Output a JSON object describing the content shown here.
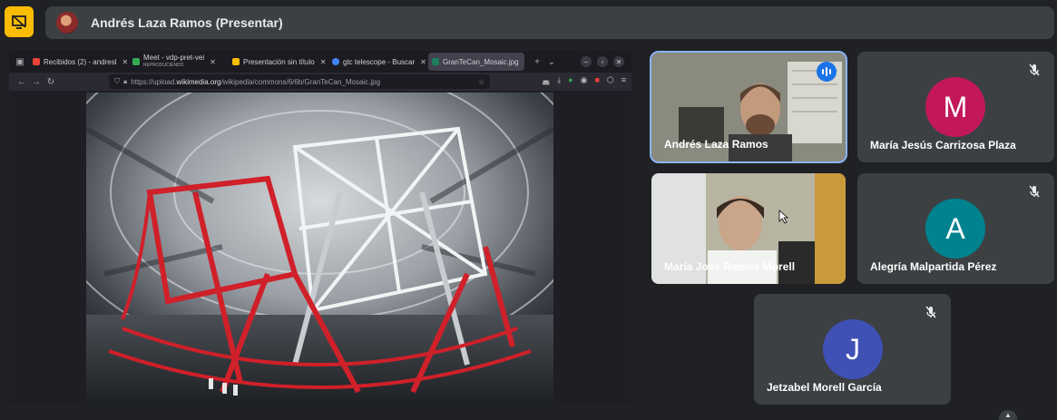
{
  "meeting": {
    "presenter_title": "Andrés Laza Ramos (Presentar)"
  },
  "browser": {
    "tabs": [
      {
        "label": "Recibidos (2) - andresl",
        "color": "#ea4335"
      },
      {
        "label": "Meet - vdp-pret-vei",
        "sub": "REPRODUCIENDO",
        "color": "#34a853"
      },
      {
        "label": "Presentación sin título",
        "color": "#fbbc04"
      },
      {
        "label": "gtc telescope - Buscar",
        "color": "#4285f4"
      },
      {
        "label": "GranTeCan_Mosaic.jpg",
        "color": "#1a7f5a"
      }
    ],
    "url_prefix": "https://upload.",
    "url_domain": "wikimedia.org",
    "url_suffix": "/wikipedia/commons/6/6b/GranTeCan_Mosaic.jpg"
  },
  "participants": [
    {
      "name": "Andrés Laza Ramos"
    },
    {
      "name": "María Jesús Carrizosa Plaza",
      "initial": "M",
      "color": "#c2185b"
    },
    {
      "name": "María José Ramos Morell"
    },
    {
      "name": "Alegría Malpartida Pérez",
      "initial": "A",
      "color": "#00838f"
    },
    {
      "name": "Jetzabel Morell García",
      "initial": "J",
      "color": "#3f51b5"
    }
  ]
}
